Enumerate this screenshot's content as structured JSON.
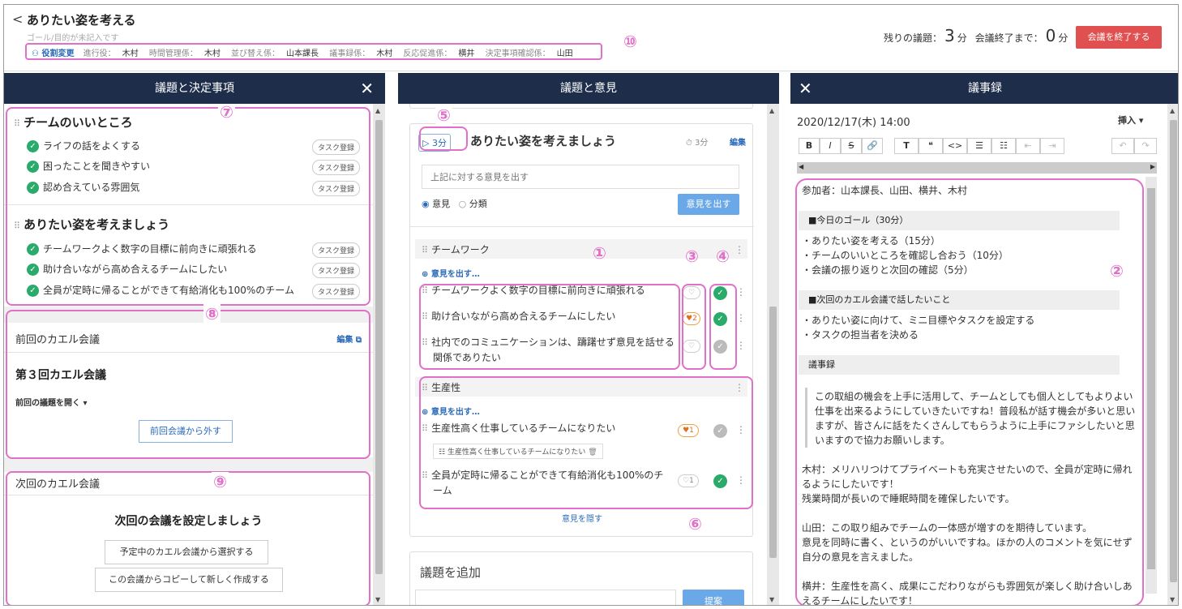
{
  "header": {
    "back": "<",
    "title": "ありたい姿を考える",
    "goal": "ゴール/目的が未記入です",
    "roles_button": "役割変更",
    "roles": [
      {
        "k": "進行役：",
        "v": "木村"
      },
      {
        "k": "時間管理係：",
        "v": "木村"
      },
      {
        "k": "並び替え係：",
        "v": "山本課長"
      },
      {
        "k": "議事録係：",
        "v": "木村"
      },
      {
        "k": "反応促進係：",
        "v": "横井"
      },
      {
        "k": "決定事項確認係：",
        "v": "山田"
      }
    ],
    "remaining_label": "残りの議題：",
    "remaining_value": "3",
    "remaining_unit": "分",
    "end_label": "会議終了まで：",
    "end_value": "0",
    "end_unit": "分",
    "end_button": "会議を終了する"
  },
  "left": {
    "title": "議題と決定事項",
    "close": "✕",
    "topic1": {
      "title": "チームのいいところ",
      "items": [
        "ライフの話をよくする",
        "困ったことを聞きやすい",
        "認め合えている雰囲気"
      ]
    },
    "topic2": {
      "title": "ありたい姿を考えましょう",
      "items": [
        "チームワークよく数字の目標に前向きに頑張れる",
        "助け合いながら高め合えるチームにしたい",
        "全員が定時に帰ることができて有給消化も100%のチーム"
      ]
    },
    "task_label": "タスク登録",
    "prev": {
      "title": "前回のカエル会議",
      "edit": "編集",
      "meeting": "第３回カエル会議",
      "open": "前回の議題を開く",
      "remove": "前回会議から外す"
    },
    "next": {
      "title": "次回のカエル会議",
      "heading": "次回の会議を設定しましょう",
      "select": "予定中のカエル会議から選択する",
      "copy": "この会議からコピーして新しく作成する"
    }
  },
  "middle": {
    "title": "議題と意見",
    "timer": "3分",
    "topic": "ありたい姿を考えましょう",
    "topic_time": "3分",
    "edit": "編集",
    "input_placeholder": "上記に対する意見を出す",
    "radio1": "意見",
    "radio2": "分類",
    "submit": "意見を出す",
    "group1": {
      "title": "チームワーク",
      "add": "意見を出す…",
      "ops": [
        "チームワークよく数字の目標に前向きに頑張れる",
        "助け合いながら高め合えるチームにしたい",
        "社内でのコミュニケーションは、躊躇せず意見を話せる",
        "関係でありたい"
      ],
      "heart2": "2"
    },
    "group2": {
      "title": "生産性",
      "add": "意見を出す…",
      "ops": [
        "生産性高く仕事しているチームになりたい",
        "全員が定時に帰ることができて有給消化も100%のチ",
        "ーム"
      ],
      "tag": "生産性高く仕事しているチームになりたい",
      "heart1": "1",
      "heart2": "1"
    },
    "hide": "意見を隠す",
    "add_topic": "議題を追加",
    "propose": "提案"
  },
  "right": {
    "title": "議事録",
    "close": "✕",
    "date": "2020/12/17(木) 14:00",
    "insert": "挿入",
    "toolbar": [
      "B",
      "I",
      "S",
      "🔗",
      "T",
      "❝",
      "<>",
      "☰",
      "☷",
      "⇤",
      "⇥",
      "↶",
      "↷"
    ],
    "participants": "参加者：山本課長、山田、横井、木村",
    "goal_head": "■今日のゴール（30分）",
    "goal_items": [
      "・ありたい姿を考える（15分）",
      "・チームのいいところを確認し合おう（10分）",
      "・会議の振り返りと次回の確認（5分）"
    ],
    "next_head": "■次回のカエル会議で話したいこと",
    "next_items": [
      "・ありたい姿に向けて、ミニ目標やタスクを設定する",
      "・タスクの担当者を決める"
    ],
    "minutes_head": "議事録",
    "quote": [
      "この取組の機会を上手に活用して、チームとしても個人としてもよりよい",
      "仕事を出来るようにしていきたいですね！普段私が話す機会が多いと思い",
      "ますが、皆さんに話をたくさんしてもらうように上手にファシしたいと思",
      "いますので協力お願いします。"
    ],
    "notes": [
      "木村：メリハリつけてプライベートも充実させたいので、全員が定時に帰れ",
      "るようにしたいです！",
      "残業時間が長いので睡眠時間を確保したいです。",
      "",
      "山田：この取り組みでチームの一体感が増すのを期待しています。",
      "意見を同時に書く、というのがいいですね。ほかの人のコメントを気にせず",
      "自分の意見を言えました。",
      "",
      "横井：生産性を高く、成果にこだわりながらも雰囲気が楽しく助け合いしあ",
      "えるチームにしたいです！"
    ]
  },
  "callouts": [
    "①",
    "②",
    "③",
    "④",
    "⑤",
    "⑥",
    "⑦",
    "⑧",
    "⑨",
    "⑩"
  ],
  "colors": {
    "accent": "#e070c8",
    "header": "#1d2d4a",
    "check": "#2bab6b",
    "end": "#e05050"
  }
}
